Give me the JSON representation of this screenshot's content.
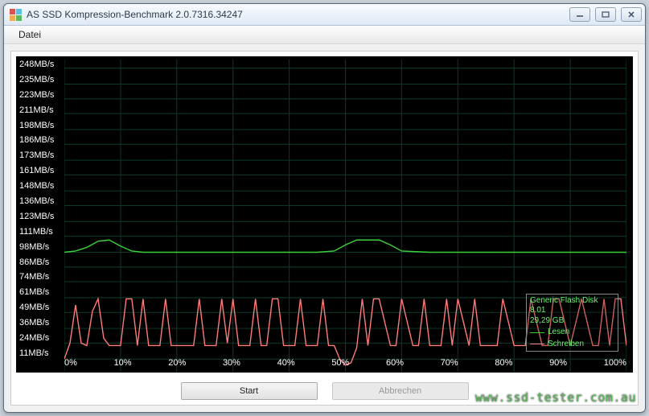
{
  "window": {
    "title": "AS SSD Kompression-Benchmark 2.0.7316.34247"
  },
  "menu": {
    "file": "Datei"
  },
  "chart_data": {
    "type": "line",
    "xlabel": "",
    "ylabel": "",
    "x_ticks": [
      "0%",
      "10%",
      "20%",
      "30%",
      "40%",
      "50%",
      "60%",
      "70%",
      "80%",
      "90%",
      "100%"
    ],
    "y_ticks": [
      "248MB/s",
      "235MB/s",
      "223MB/s",
      "211MB/s",
      "198MB/s",
      "186MB/s",
      "173MB/s",
      "161MB/s",
      "148MB/s",
      "136MB/s",
      "123MB/s",
      "111MB/s",
      "98MB/s",
      "86MB/s",
      "74MB/s",
      "61MB/s",
      "49MB/s",
      "36MB/s",
      "24MB/s",
      "11MB/s"
    ],
    "ylim": [
      0,
      255
    ],
    "xlim": [
      0,
      100
    ],
    "series": [
      {
        "name": "Lesen",
        "color": "#3bd13b",
        "x": [
          0,
          2,
          4,
          6,
          8,
          10,
          12,
          14,
          16,
          18,
          20,
          25,
          30,
          35,
          40,
          45,
          48,
          50,
          52,
          54,
          56,
          58,
          60,
          65,
          70,
          75,
          80,
          85,
          90,
          95,
          100
        ],
        "y": [
          98,
          99,
          102,
          107,
          108,
          103,
          99,
          98,
          98,
          98,
          98,
          98,
          98,
          98,
          98,
          98,
          99,
          104,
          108,
          108,
          108,
          104,
          99,
          98,
          98,
          98,
          98,
          98,
          98,
          98,
          98
        ]
      },
      {
        "name": "Schreiben",
        "color": "#ff7a7a",
        "x": [
          0,
          1,
          2,
          3,
          4,
          5,
          6,
          7,
          8,
          9,
          10,
          11,
          12,
          13,
          14,
          15,
          17,
          18,
          19,
          20,
          22,
          23,
          24,
          25,
          26,
          27,
          28,
          29,
          30,
          31,
          32,
          33,
          34,
          35,
          36,
          37,
          38,
          39,
          40,
          41,
          42,
          43,
          44,
          45,
          46,
          47,
          48,
          49,
          50,
          51,
          52,
          53,
          54,
          55,
          56,
          58,
          59,
          60,
          62,
          63,
          64,
          65,
          67,
          68,
          69,
          70,
          72,
          73,
          74,
          75,
          77,
          78,
          80,
          82,
          83,
          85,
          86,
          87,
          88,
          90,
          92,
          94,
          95,
          96,
          97,
          98,
          99,
          100
        ],
        "y": [
          11,
          24,
          55,
          24,
          22,
          50,
          60,
          28,
          22,
          22,
          22,
          60,
          60,
          22,
          60,
          22,
          22,
          60,
          22,
          22,
          22,
          22,
          60,
          22,
          22,
          22,
          60,
          24,
          60,
          22,
          22,
          22,
          60,
          22,
          22,
          60,
          60,
          22,
          22,
          22,
          60,
          22,
          22,
          22,
          60,
          22,
          22,
          11,
          6,
          8,
          20,
          60,
          22,
          60,
          60,
          22,
          22,
          60,
          22,
          22,
          60,
          22,
          22,
          60,
          22,
          60,
          22,
          60,
          22,
          22,
          22,
          60,
          22,
          22,
          60,
          22,
          22,
          60,
          60,
          22,
          60,
          22,
          22,
          60,
          22,
          60,
          60,
          22
        ]
      }
    ],
    "legend": {
      "disk_name": "Generic Flash Disk 8.01",
      "capacity": "29,29 GB",
      "entries": [
        "Lesen",
        "Schreiben"
      ]
    }
  },
  "buttons": {
    "start": "Start",
    "cancel": "Abbrechen"
  },
  "watermark": "www.ssd-tester.com.au"
}
